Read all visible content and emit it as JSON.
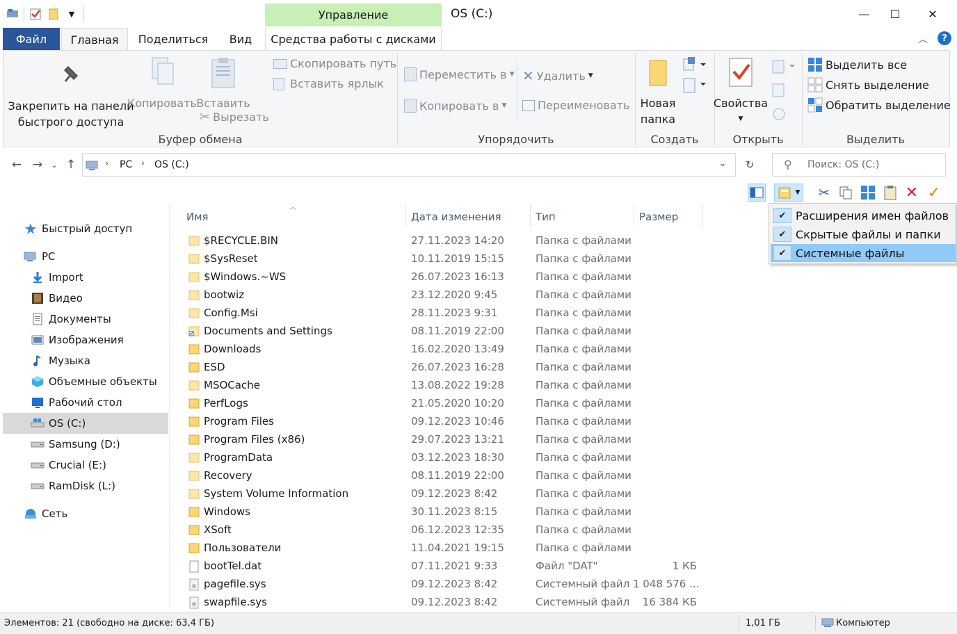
{
  "window": {
    "title": "OS (C:)",
    "context_tab": "Управление",
    "minimize": "—",
    "maximize": "☐",
    "close": "✕"
  },
  "tabs": {
    "file": "Файл",
    "home": "Главная",
    "share": "Поделиться",
    "view": "Вид",
    "disk_tools": "Средства работы с дисками"
  },
  "ribbon": {
    "pin": [
      "Закрепить на панели",
      "быстрого доступа"
    ],
    "copy": "Копировать",
    "paste": "Вставить",
    "copy_path": "Скопировать путь",
    "paste_shortcut": "Вставить ярлык",
    "cut": "Вырезать",
    "clipboard_group": "Буфер обмена",
    "move_to": "Переместить в",
    "copy_to": "Копировать в",
    "delete": "Удалить",
    "rename": "Переименовать",
    "organize_group": "Упорядочить",
    "new_folder": [
      "Новая",
      "папка"
    ],
    "create_group": "Создать",
    "properties": "Свойства",
    "open_group": "Открыть",
    "select_all": "Выделить все",
    "select_none": "Снять выделение",
    "invert_selection": "Обратить выделение",
    "select_group": "Выделить"
  },
  "address": {
    "crumbs": [
      "PC",
      "OS (C:)"
    ],
    "search_placeholder": "Поиск: OS (C:)"
  },
  "dropdown_menu": [
    {
      "label": "Расширения имен файлов",
      "checked": true,
      "highlighted": false
    },
    {
      "label": "Скрытые файлы и папки",
      "checked": true,
      "highlighted": false
    },
    {
      "label": "Системные файлы",
      "checked": true,
      "highlighted": true
    }
  ],
  "nav": [
    {
      "label": "Быстрый доступ",
      "icon": "star-icon",
      "level": 1
    },
    {
      "label": "PC",
      "icon": "computer-icon",
      "level": 1
    },
    {
      "label": "Import",
      "icon": "download-icon",
      "level": 2
    },
    {
      "label": "Видео",
      "icon": "video-icon",
      "level": 2
    },
    {
      "label": "Документы",
      "icon": "documents-icon",
      "level": 2
    },
    {
      "label": "Изображения",
      "icon": "pictures-icon",
      "level": 2
    },
    {
      "label": "Музыка",
      "icon": "music-icon",
      "level": 2
    },
    {
      "label": "Объемные объекты",
      "icon": "3d-objects-icon",
      "level": 2
    },
    {
      "label": "Рабочий стол",
      "icon": "desktop-icon",
      "level": 2
    },
    {
      "label": "OS (C:)",
      "icon": "system-drive-icon",
      "level": 2,
      "selected": true
    },
    {
      "label": "Samsung (D:)",
      "icon": "drive-icon",
      "level": 2
    },
    {
      "label": "Crucial (E:)",
      "icon": "drive-icon",
      "level": 2
    },
    {
      "label": "RamDisk (L:)",
      "icon": "drive-icon",
      "level": 2
    },
    {
      "label": "Сеть",
      "icon": "network-icon",
      "level": 1
    }
  ],
  "columns": {
    "name": "Имя",
    "date": "Дата изменения",
    "type": "Тип",
    "size": "Размер"
  },
  "files": [
    {
      "name": "$RECYCLE.BIN",
      "date": "27.11.2023 14:20",
      "type": "Папка с файлами",
      "size": "",
      "kind": "folder-hidden"
    },
    {
      "name": "$SysReset",
      "date": "10.11.2019 15:15",
      "type": "Папка с файлами",
      "size": "",
      "kind": "folder-hidden"
    },
    {
      "name": "$Windows.~WS",
      "date": "26.07.2023 16:13",
      "type": "Папка с файлами",
      "size": "",
      "kind": "folder-hidden"
    },
    {
      "name": "bootwiz",
      "date": "23.12.2020 9:45",
      "type": "Папка с файлами",
      "size": "",
      "kind": "folder-hidden"
    },
    {
      "name": "Config.Msi",
      "date": "28.11.2023 9:31",
      "type": "Папка с файлами",
      "size": "",
      "kind": "folder-hidden"
    },
    {
      "name": "Documents and Settings",
      "date": "08.11.2019 22:00",
      "type": "Папка с файлами",
      "size": "",
      "kind": "link"
    },
    {
      "name": "Downloads",
      "date": "16.02.2020 13:49",
      "type": "Папка с файлами",
      "size": "",
      "kind": "folder"
    },
    {
      "name": "ESD",
      "date": "26.07.2023 16:28",
      "type": "Папка с файлами",
      "size": "",
      "kind": "folder"
    },
    {
      "name": "MSOCache",
      "date": "13.08.2022 19:28",
      "type": "Папка с файлами",
      "size": "",
      "kind": "folder-hidden"
    },
    {
      "name": "PerfLogs",
      "date": "21.05.2020 10:20",
      "type": "Папка с файлами",
      "size": "",
      "kind": "folder"
    },
    {
      "name": "Program Files",
      "date": "09.12.2023 10:46",
      "type": "Папка с файлами",
      "size": "",
      "kind": "folder"
    },
    {
      "name": "Program Files (x86)",
      "date": "29.07.2023 13:21",
      "type": "Папка с файлами",
      "size": "",
      "kind": "folder"
    },
    {
      "name": "ProgramData",
      "date": "03.12.2023 18:30",
      "type": "Папка с файлами",
      "size": "",
      "kind": "folder-hidden"
    },
    {
      "name": "Recovery",
      "date": "08.11.2019 22:00",
      "type": "Папка с файлами",
      "size": "",
      "kind": "folder-hidden"
    },
    {
      "name": "System Volume Information",
      "date": "09.12.2023 8:42",
      "type": "Папка с файлами",
      "size": "",
      "kind": "folder-hidden"
    },
    {
      "name": "Windows",
      "date": "30.11.2023 8:15",
      "type": "Папка с файлами",
      "size": "",
      "kind": "folder"
    },
    {
      "name": "XSoft",
      "date": "06.12.2023 12:35",
      "type": "Папка с файлами",
      "size": "",
      "kind": "folder"
    },
    {
      "name": "Пользователи",
      "date": "11.04.2021 19:15",
      "type": "Папка с файлами",
      "size": "",
      "kind": "folder"
    },
    {
      "name": "bootTel.dat",
      "date": "07.11.2021 9:33",
      "type": "Файл \"DAT\"",
      "size": "1 КБ",
      "kind": "file"
    },
    {
      "name": "pagefile.sys",
      "date": "09.12.2023 8:42",
      "type": "Системный файл",
      "size": "1 048 576 ...",
      "kind": "sysfile"
    },
    {
      "name": "swapfile.sys",
      "date": "09.12.2023 8:42",
      "type": "Системный файл",
      "size": "16 384 КБ",
      "kind": "sysfile"
    }
  ],
  "status": {
    "items": "Элементов: 21 (свободно на диске: 63,4 ГБ)",
    "size": "1,01 ГБ",
    "location": "Компьютер"
  },
  "colors": {
    "accent": "#2b579a",
    "context": "#c8efb6",
    "folder": "#f8d775",
    "selection": "#cce8ff"
  }
}
